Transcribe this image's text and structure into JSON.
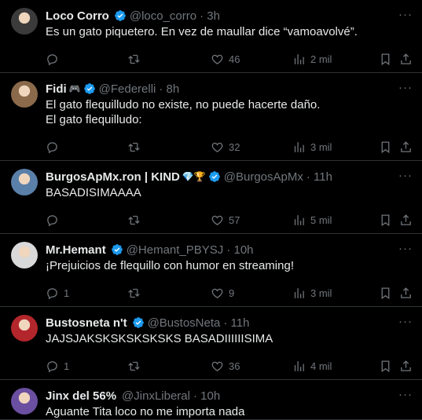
{
  "tweets": [
    {
      "name": "Loco Corro",
      "emoji": "",
      "verified": true,
      "handle": "@loco_corro",
      "time": "· 3h",
      "text": "Es un gato piquetero. En vez de maullar dice “vamoavolvé”.",
      "replies": "",
      "likes": "46",
      "views": "2 mil",
      "avatar_color": "#3b3b3b"
    },
    {
      "name": "Fidi",
      "emoji": "🎮",
      "verified": true,
      "handle": "@Federelli",
      "time": "· 8h",
      "text": "El gato flequilludo no existe, no puede hacerte daño.\nEl gato flequilludo:",
      "replies": "",
      "likes": "32",
      "views": "3 mil",
      "avatar_color": "#8a6a4a"
    },
    {
      "name": "BurgosApMx.ron | KIND",
      "emoji": "💎🏆",
      "verified": true,
      "handle": "@BurgosApMx",
      "time": "· 11h",
      "text": "BASADISIMAAAA",
      "replies": "",
      "likes": "57",
      "views": "5 mil",
      "avatar_color": "#5a7fa8"
    },
    {
      "name": "Mr.Hemant",
      "emoji": "",
      "verified": true,
      "handle": "@Hemant_PBYSJ",
      "time": "· 10h",
      "text": "¡Prejuicios de flequillo con humor en streaming!",
      "replies": "1",
      "likes": "9",
      "views": "3 mil",
      "avatar_color": "#d9d9d9"
    },
    {
      "name": "Bustosneta n't",
      "emoji": "",
      "verified": true,
      "handle": "@BustosNeta",
      "time": "· 11h",
      "text": "JAJSJAKSKSKSKSKSKS BASADIIIIIISIMA",
      "replies": "1",
      "likes": "36",
      "views": "4 mil",
      "avatar_color": "#b3262b"
    },
    {
      "name": "Jinx del 56%",
      "emoji": "",
      "verified": false,
      "handle": "@JinxLiberal",
      "time": "· 10h",
      "text": "Aguante Tita loco no me importa nada",
      "replies": "",
      "likes": "",
      "views": "",
      "avatar_color": "#6b4fa0"
    }
  ],
  "colors": {
    "background": "#000000",
    "text": "#e7e9ea",
    "secondary": "#71767b",
    "verified": "#1d9bf0",
    "divider": "#2f3336"
  },
  "icons": {
    "reply": "reply-icon",
    "retweet": "retweet-icon",
    "like": "like-icon",
    "views": "views-icon",
    "bookmark": "bookmark-icon",
    "share": "share-icon",
    "more": "more-icon"
  }
}
